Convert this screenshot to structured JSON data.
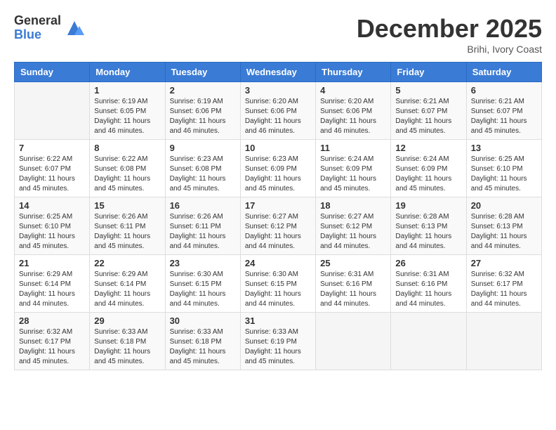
{
  "header": {
    "logo_general": "General",
    "logo_blue": "Blue",
    "month_title": "December 2025",
    "location": "Brihi, Ivory Coast"
  },
  "weekdays": [
    "Sunday",
    "Monday",
    "Tuesday",
    "Wednesday",
    "Thursday",
    "Friday",
    "Saturday"
  ],
  "weeks": [
    [
      {
        "day": "",
        "sunrise": "",
        "sunset": "",
        "daylight": ""
      },
      {
        "day": "1",
        "sunrise": "Sunrise: 6:19 AM",
        "sunset": "Sunset: 6:05 PM",
        "daylight": "Daylight: 11 hours and 46 minutes."
      },
      {
        "day": "2",
        "sunrise": "Sunrise: 6:19 AM",
        "sunset": "Sunset: 6:06 PM",
        "daylight": "Daylight: 11 hours and 46 minutes."
      },
      {
        "day": "3",
        "sunrise": "Sunrise: 6:20 AM",
        "sunset": "Sunset: 6:06 PM",
        "daylight": "Daylight: 11 hours and 46 minutes."
      },
      {
        "day": "4",
        "sunrise": "Sunrise: 6:20 AM",
        "sunset": "Sunset: 6:06 PM",
        "daylight": "Daylight: 11 hours and 46 minutes."
      },
      {
        "day": "5",
        "sunrise": "Sunrise: 6:21 AM",
        "sunset": "Sunset: 6:07 PM",
        "daylight": "Daylight: 11 hours and 45 minutes."
      },
      {
        "day": "6",
        "sunrise": "Sunrise: 6:21 AM",
        "sunset": "Sunset: 6:07 PM",
        "daylight": "Daylight: 11 hours and 45 minutes."
      }
    ],
    [
      {
        "day": "7",
        "sunrise": "Sunrise: 6:22 AM",
        "sunset": "Sunset: 6:07 PM",
        "daylight": "Daylight: 11 hours and 45 minutes."
      },
      {
        "day": "8",
        "sunrise": "Sunrise: 6:22 AM",
        "sunset": "Sunset: 6:08 PM",
        "daylight": "Daylight: 11 hours and 45 minutes."
      },
      {
        "day": "9",
        "sunrise": "Sunrise: 6:23 AM",
        "sunset": "Sunset: 6:08 PM",
        "daylight": "Daylight: 11 hours and 45 minutes."
      },
      {
        "day": "10",
        "sunrise": "Sunrise: 6:23 AM",
        "sunset": "Sunset: 6:09 PM",
        "daylight": "Daylight: 11 hours and 45 minutes."
      },
      {
        "day": "11",
        "sunrise": "Sunrise: 6:24 AM",
        "sunset": "Sunset: 6:09 PM",
        "daylight": "Daylight: 11 hours and 45 minutes."
      },
      {
        "day": "12",
        "sunrise": "Sunrise: 6:24 AM",
        "sunset": "Sunset: 6:09 PM",
        "daylight": "Daylight: 11 hours and 45 minutes."
      },
      {
        "day": "13",
        "sunrise": "Sunrise: 6:25 AM",
        "sunset": "Sunset: 6:10 PM",
        "daylight": "Daylight: 11 hours and 45 minutes."
      }
    ],
    [
      {
        "day": "14",
        "sunrise": "Sunrise: 6:25 AM",
        "sunset": "Sunset: 6:10 PM",
        "daylight": "Daylight: 11 hours and 45 minutes."
      },
      {
        "day": "15",
        "sunrise": "Sunrise: 6:26 AM",
        "sunset": "Sunset: 6:11 PM",
        "daylight": "Daylight: 11 hours and 45 minutes."
      },
      {
        "day": "16",
        "sunrise": "Sunrise: 6:26 AM",
        "sunset": "Sunset: 6:11 PM",
        "daylight": "Daylight: 11 hours and 44 minutes."
      },
      {
        "day": "17",
        "sunrise": "Sunrise: 6:27 AM",
        "sunset": "Sunset: 6:12 PM",
        "daylight": "Daylight: 11 hours and 44 minutes."
      },
      {
        "day": "18",
        "sunrise": "Sunrise: 6:27 AM",
        "sunset": "Sunset: 6:12 PM",
        "daylight": "Daylight: 11 hours and 44 minutes."
      },
      {
        "day": "19",
        "sunrise": "Sunrise: 6:28 AM",
        "sunset": "Sunset: 6:13 PM",
        "daylight": "Daylight: 11 hours and 44 minutes."
      },
      {
        "day": "20",
        "sunrise": "Sunrise: 6:28 AM",
        "sunset": "Sunset: 6:13 PM",
        "daylight": "Daylight: 11 hours and 44 minutes."
      }
    ],
    [
      {
        "day": "21",
        "sunrise": "Sunrise: 6:29 AM",
        "sunset": "Sunset: 6:14 PM",
        "daylight": "Daylight: 11 hours and 44 minutes."
      },
      {
        "day": "22",
        "sunrise": "Sunrise: 6:29 AM",
        "sunset": "Sunset: 6:14 PM",
        "daylight": "Daylight: 11 hours and 44 minutes."
      },
      {
        "day": "23",
        "sunrise": "Sunrise: 6:30 AM",
        "sunset": "Sunset: 6:15 PM",
        "daylight": "Daylight: 11 hours and 44 minutes."
      },
      {
        "day": "24",
        "sunrise": "Sunrise: 6:30 AM",
        "sunset": "Sunset: 6:15 PM",
        "daylight": "Daylight: 11 hours and 44 minutes."
      },
      {
        "day": "25",
        "sunrise": "Sunrise: 6:31 AM",
        "sunset": "Sunset: 6:16 PM",
        "daylight": "Daylight: 11 hours and 44 minutes."
      },
      {
        "day": "26",
        "sunrise": "Sunrise: 6:31 AM",
        "sunset": "Sunset: 6:16 PM",
        "daylight": "Daylight: 11 hours and 44 minutes."
      },
      {
        "day": "27",
        "sunrise": "Sunrise: 6:32 AM",
        "sunset": "Sunset: 6:17 PM",
        "daylight": "Daylight: 11 hours and 44 minutes."
      }
    ],
    [
      {
        "day": "28",
        "sunrise": "Sunrise: 6:32 AM",
        "sunset": "Sunset: 6:17 PM",
        "daylight": "Daylight: 11 hours and 45 minutes."
      },
      {
        "day": "29",
        "sunrise": "Sunrise: 6:33 AM",
        "sunset": "Sunset: 6:18 PM",
        "daylight": "Daylight: 11 hours and 45 minutes."
      },
      {
        "day": "30",
        "sunrise": "Sunrise: 6:33 AM",
        "sunset": "Sunset: 6:18 PM",
        "daylight": "Daylight: 11 hours and 45 minutes."
      },
      {
        "day": "31",
        "sunrise": "Sunrise: 6:33 AM",
        "sunset": "Sunset: 6:19 PM",
        "daylight": "Daylight: 11 hours and 45 minutes."
      },
      {
        "day": "",
        "sunrise": "",
        "sunset": "",
        "daylight": ""
      },
      {
        "day": "",
        "sunrise": "",
        "sunset": "",
        "daylight": ""
      },
      {
        "day": "",
        "sunrise": "",
        "sunset": "",
        "daylight": ""
      }
    ]
  ]
}
